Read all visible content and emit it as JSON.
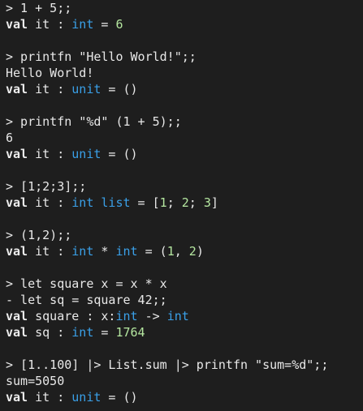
{
  "session": {
    "lines": [
      [
        {
          "t": "> 1 + 5;;",
          "s": "w"
        }
      ],
      [
        {
          "t": "val",
          "s": "b"
        },
        {
          "t": " it : ",
          "s": "p"
        },
        {
          "t": "int",
          "s": "t"
        },
        {
          "t": " = ",
          "s": "p"
        },
        {
          "t": "6",
          "s": "n"
        }
      ],
      [],
      [
        {
          "t": "> printfn \"Hello World!\";;",
          "s": "w"
        }
      ],
      [
        {
          "t": "Hello World!",
          "s": "w"
        }
      ],
      [
        {
          "t": "val",
          "s": "b"
        },
        {
          "t": " it : ",
          "s": "p"
        },
        {
          "t": "unit",
          "s": "t"
        },
        {
          "t": " = ()",
          "s": "p"
        }
      ],
      [],
      [
        {
          "t": "> printfn \"%d\" (1 + 5);;",
          "s": "w"
        }
      ],
      [
        {
          "t": "6",
          "s": "w"
        }
      ],
      [
        {
          "t": "val",
          "s": "b"
        },
        {
          "t": " it : ",
          "s": "p"
        },
        {
          "t": "unit",
          "s": "t"
        },
        {
          "t": " = ()",
          "s": "p"
        }
      ],
      [],
      [
        {
          "t": "> [1;2;3];;",
          "s": "w"
        }
      ],
      [
        {
          "t": "val",
          "s": "b"
        },
        {
          "t": " it : ",
          "s": "p"
        },
        {
          "t": "int list",
          "s": "t"
        },
        {
          "t": " = [",
          "s": "p"
        },
        {
          "t": "1",
          "s": "n"
        },
        {
          "t": "; ",
          "s": "p"
        },
        {
          "t": "2",
          "s": "n"
        },
        {
          "t": "; ",
          "s": "p"
        },
        {
          "t": "3",
          "s": "n"
        },
        {
          "t": "]",
          "s": "p"
        }
      ],
      [],
      [
        {
          "t": "> (1,2);;",
          "s": "w"
        }
      ],
      [
        {
          "t": "val",
          "s": "b"
        },
        {
          "t": " it : ",
          "s": "p"
        },
        {
          "t": "int",
          "s": "t"
        },
        {
          "t": " * ",
          "s": "p"
        },
        {
          "t": "int",
          "s": "t"
        },
        {
          "t": " = (",
          "s": "p"
        },
        {
          "t": "1",
          "s": "n"
        },
        {
          "t": ", ",
          "s": "p"
        },
        {
          "t": "2",
          "s": "n"
        },
        {
          "t": ")",
          "s": "p"
        }
      ],
      [],
      [
        {
          "t": "> let square x = x * x",
          "s": "w"
        }
      ],
      [
        {
          "t": "- let sq = square 42;;",
          "s": "w"
        }
      ],
      [
        {
          "t": "val",
          "s": "b"
        },
        {
          "t": " square : x:",
          "s": "p"
        },
        {
          "t": "int",
          "s": "t"
        },
        {
          "t": " -> ",
          "s": "p"
        },
        {
          "t": "int",
          "s": "t"
        }
      ],
      [
        {
          "t": "val",
          "s": "b"
        },
        {
          "t": " sq : ",
          "s": "p"
        },
        {
          "t": "int",
          "s": "t"
        },
        {
          "t": " = ",
          "s": "p"
        },
        {
          "t": "1764",
          "s": "n"
        }
      ],
      [],
      [
        {
          "t": "> [1..100] |> List.sum |> printfn \"sum=%d\";;",
          "s": "w"
        }
      ],
      [
        {
          "t": "sum=5050",
          "s": "w"
        }
      ],
      [
        {
          "t": "val",
          "s": "b"
        },
        {
          "t": " it : ",
          "s": "p"
        },
        {
          "t": "unit",
          "s": "t"
        },
        {
          "t": " = ()",
          "s": "p"
        }
      ]
    ]
  },
  "colors": {
    "background": "#1e1e1e",
    "text": "#e8e8e8",
    "type": "#3aa0e8",
    "number": "#b5e7a0"
  }
}
